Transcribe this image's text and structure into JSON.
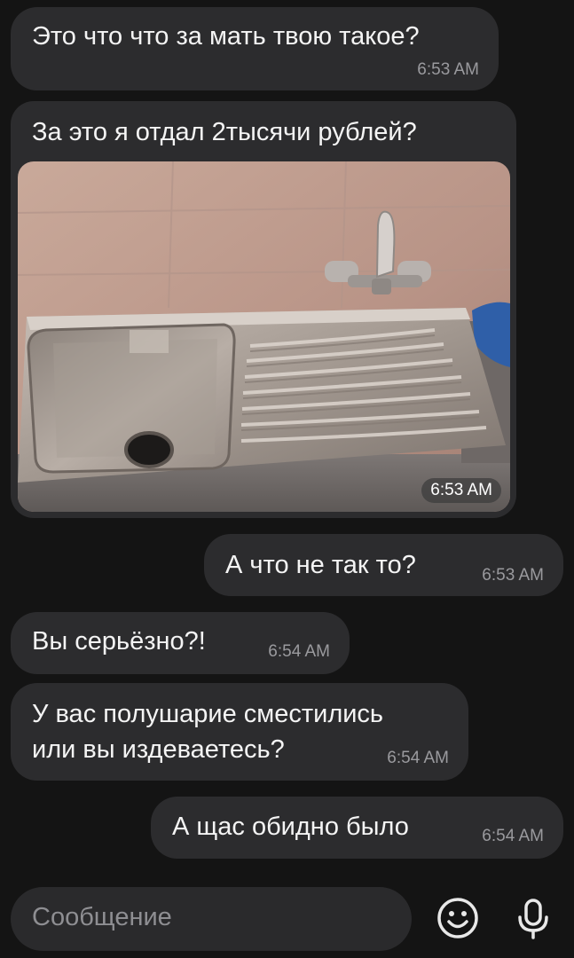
{
  "messages": [
    {
      "text": "Это что что за мать твою такое?",
      "time": "6:53 AM"
    },
    {
      "text": "За это я отдал 2тысячи рублей?",
      "time": "6:53 AM"
    },
    {
      "text": "А что не так то?",
      "time": "6:53 AM"
    },
    {
      "text": "Вы серьёзно?!",
      "time": "6:54 AM"
    },
    {
      "line1": "У вас полушарие сместились",
      "line2": "или вы издеваетесь?",
      "time": "6:54 AM"
    },
    {
      "text": "А щас обидно было",
      "time": "6:54 AM"
    }
  ],
  "composer": {
    "placeholder": "Сообщение",
    "emoji_icon": "smiley-icon",
    "mic_icon": "microphone-icon"
  },
  "colors": {
    "background": "#141414",
    "bubble": "#2c2c2e",
    "text": "#f4f4f4",
    "timestamp": "#9a9a9e"
  }
}
